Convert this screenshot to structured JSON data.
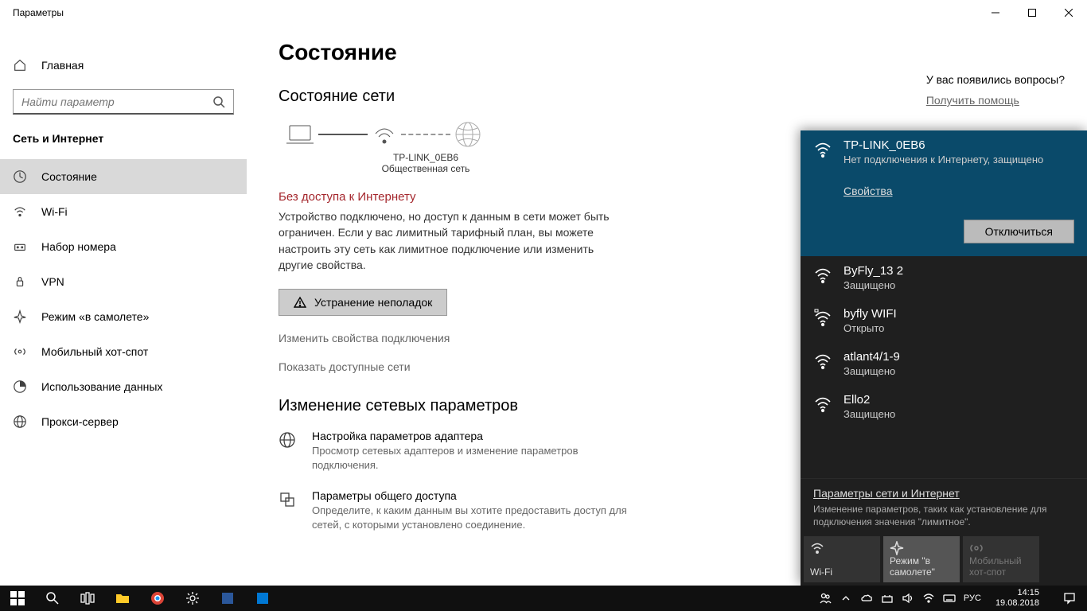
{
  "window": {
    "title": "Параметры"
  },
  "sidebar": {
    "home": "Главная",
    "search_placeholder": "Найти параметр",
    "category": "Сеть и Интернет",
    "items": [
      {
        "label": "Состояние"
      },
      {
        "label": "Wi-Fi"
      },
      {
        "label": "Набор номера"
      },
      {
        "label": "VPN"
      },
      {
        "label": "Режим «в самолете»"
      },
      {
        "label": "Мобильный хот-спот"
      },
      {
        "label": "Использование данных"
      },
      {
        "label": "Прокси-сервер"
      }
    ]
  },
  "content": {
    "title": "Состояние",
    "section_status": "Состояние сети",
    "net_name": "TP-LINK_0EB6",
    "net_type": "Общественная сеть",
    "warn": "Без доступа к Интернету",
    "desc": "Устройство подключено, но доступ к данным в сети может быть ограничен. Если у вас лимитный тарифный план, вы можете настроить эту сеть как лимитное подключение или изменить другие свойства.",
    "troubleshoot": "Устранение неполадок",
    "change_props": "Изменить свойства подключения",
    "show_nets": "Показать доступные сети",
    "section_change": "Изменение сетевых параметров",
    "opt1_title": "Настройка параметров адаптера",
    "opt1_desc": "Просмотр сетевых адаптеров и изменение параметров подключения.",
    "opt2_title": "Параметры общего доступа",
    "opt2_desc": "Определите, к каким данным вы хотите предоставить доступ для сетей, с которыми установлено соединение."
  },
  "help": {
    "q": "У вас появились вопросы?",
    "a": "Получить помощь"
  },
  "flyout": {
    "active": {
      "name": "TP-LINK_0EB6",
      "sub": "Нет подключения к Интернету, защищено",
      "props": "Свойства",
      "disconnect": "Отключиться"
    },
    "nets": [
      {
        "name": "ByFly_13 2",
        "sub": "Защищено",
        "open": false
      },
      {
        "name": "byfly WIFI",
        "sub": "Открыто",
        "open": true
      },
      {
        "name": "atlant4/1-9",
        "sub": "Защищено",
        "open": false
      },
      {
        "name": "Ello2",
        "sub": "Защищено",
        "open": false
      }
    ],
    "settings_link": "Параметры сети и Интернет",
    "settings_desc": "Изменение параметров, таких как установление для подключения значения \"лимитное\".",
    "tiles": {
      "wifi": "Wi-Fi",
      "airplane": "Режим \"в самолете\"",
      "hotspot": "Мобильный хот-спот"
    }
  },
  "taskbar": {
    "lang": "РУС",
    "time": "14:15",
    "date": "19.08.2018"
  }
}
